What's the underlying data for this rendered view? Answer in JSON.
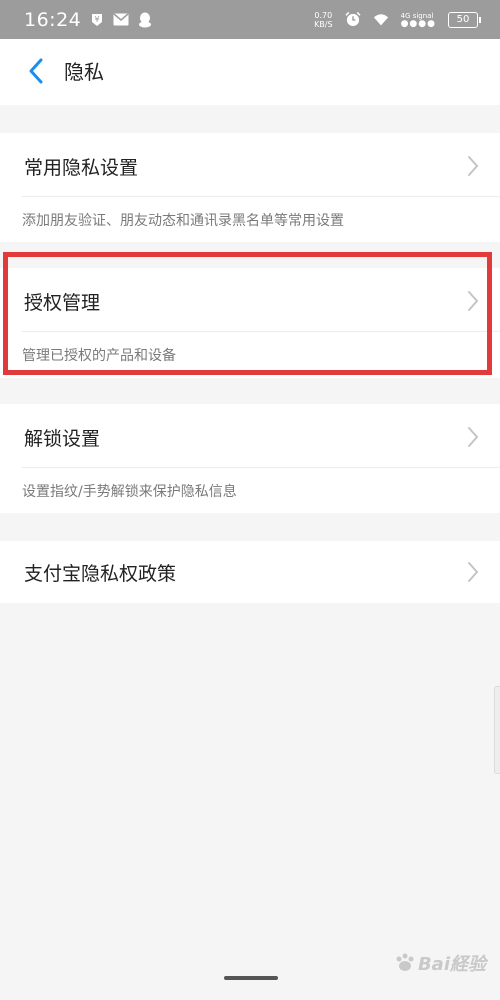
{
  "status_bar": {
    "time": "16:24",
    "net_speed_value": "0.70",
    "net_speed_unit": "KB/S",
    "signal_label": "4G",
    "signal_sub": "signal",
    "battery": "50"
  },
  "header": {
    "title": "隐私"
  },
  "sections": [
    {
      "title": "常用隐私设置",
      "desc": "添加朋友验证、朋友动态和通讯录黑名单等常用设置"
    },
    {
      "title": "授权管理",
      "desc": "管理已授权的产品和设备"
    },
    {
      "title": "解锁设置",
      "desc": "设置指纹/手势解锁来保护隐私信息"
    },
    {
      "title": "支付宝隐私权政策"
    }
  ],
  "watermark": {
    "text": "Bai経验"
  },
  "colors": {
    "accent": "#1a8df0",
    "highlight": "#e23a3a",
    "statusbar": "#9c9c9c"
  }
}
